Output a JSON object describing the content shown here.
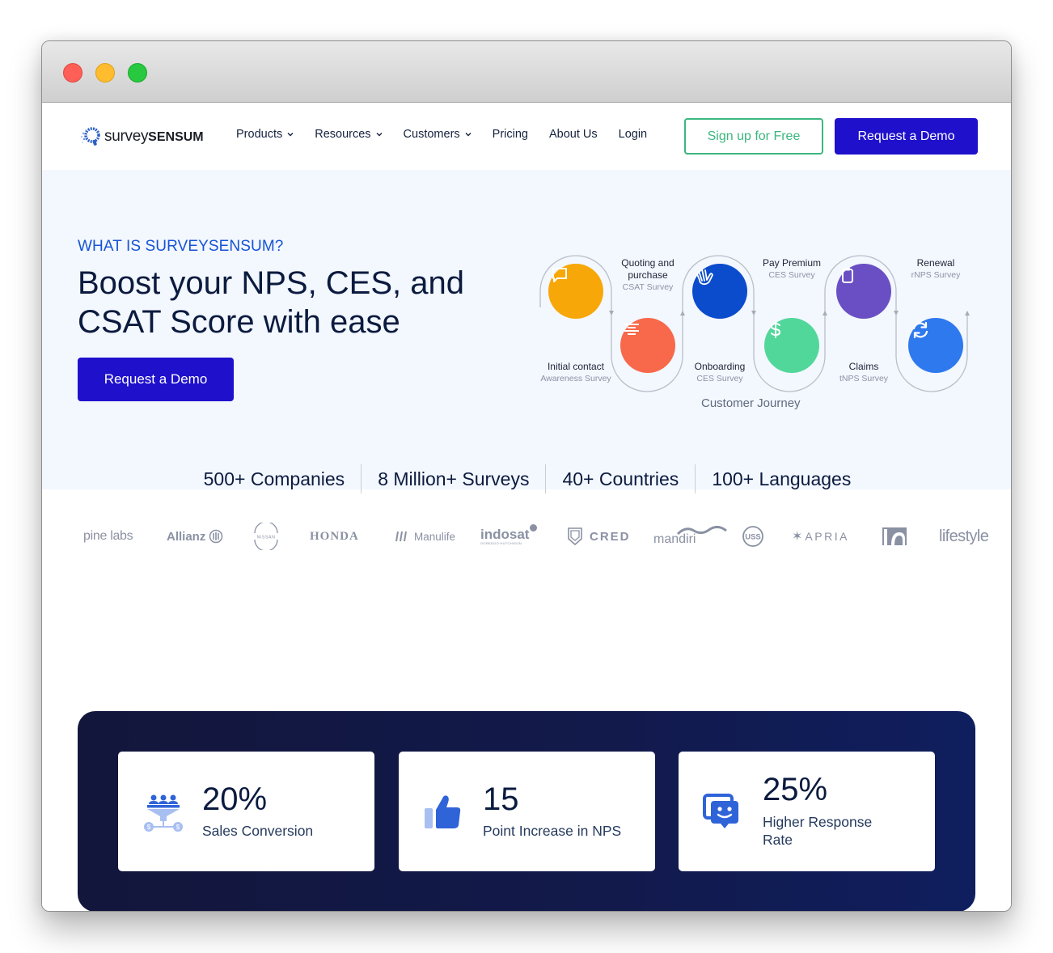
{
  "window": {
    "traffic_lights": [
      "close",
      "minimize",
      "zoom"
    ]
  },
  "nav": {
    "logo": {
      "part1": "survey",
      "part2": "SENSUM"
    },
    "items": [
      {
        "label": "Products",
        "has_dropdown": true
      },
      {
        "label": "Resources",
        "has_dropdown": true
      },
      {
        "label": "Customers",
        "has_dropdown": true
      },
      {
        "label": "Pricing",
        "has_dropdown": false
      },
      {
        "label": "About Us",
        "has_dropdown": false
      },
      {
        "label": "Login",
        "has_dropdown": false
      }
    ],
    "signup_label": "Sign up for Free",
    "demo_label": "Request a Demo"
  },
  "hero": {
    "eyebrow": "WHAT IS SURVEYSENSUM?",
    "title": "Boost your NPS, CES, and CSAT Score with ease",
    "cta_label": "Request a Demo",
    "journey": {
      "caption": "Customer Journey",
      "steps": [
        {
          "title": "Initial contact",
          "survey": "Awareness Survey",
          "icon": "chat-bubble-icon",
          "color": "#f7a707"
        },
        {
          "title": "Quoting and purchase",
          "survey": "CSAT Survey",
          "icon": "align-center-icon",
          "color": "#f7694a"
        },
        {
          "title": "Onboarding",
          "survey": "CES Survey",
          "icon": "waving-hand-icon",
          "color": "#0a4ccc"
        },
        {
          "title": "Pay Premium",
          "survey": "CES Survey",
          "icon": "dollar-icon",
          "color": "#52d79b"
        },
        {
          "title": "Claims",
          "survey": "tNPS Survey",
          "icon": "clipboard-icon",
          "color": "#6a4fc4"
        },
        {
          "title": "Renewal",
          "survey": "rNPS Survey",
          "icon": "refresh-icon",
          "color": "#2e79ee"
        }
      ]
    }
  },
  "stats": [
    "500+ Companies",
    "8 Million+ Surveys",
    "40+ Countries",
    "100+ Languages"
  ],
  "brands": [
    "pine labs",
    "Allianz",
    "NISSAN",
    "HONDA",
    "Manulife",
    "indosat",
    "CRED",
    "mandiri",
    "USS",
    "APRIA",
    "lifestyle"
  ],
  "brands_extra": {
    "indosat_sub": "OOREDOO HUTCHISON"
  },
  "results": [
    {
      "value": "20%",
      "label": "Sales Conversion",
      "icon": "funnel-people-icon"
    },
    {
      "value": "15",
      "label": "Point Increase in NPS",
      "icon": "thumbs-up-icon"
    },
    {
      "value": "25%",
      "label": "Higher Response Rate",
      "icon": "smile-chat-icon"
    }
  ],
  "colors": {
    "brand_primary": "#1f10cc",
    "signup_green": "#3bb77e",
    "eyebrow_blue": "#1554d4",
    "hero_bg": "#f3f7fe",
    "results_bg": "#13163b"
  }
}
